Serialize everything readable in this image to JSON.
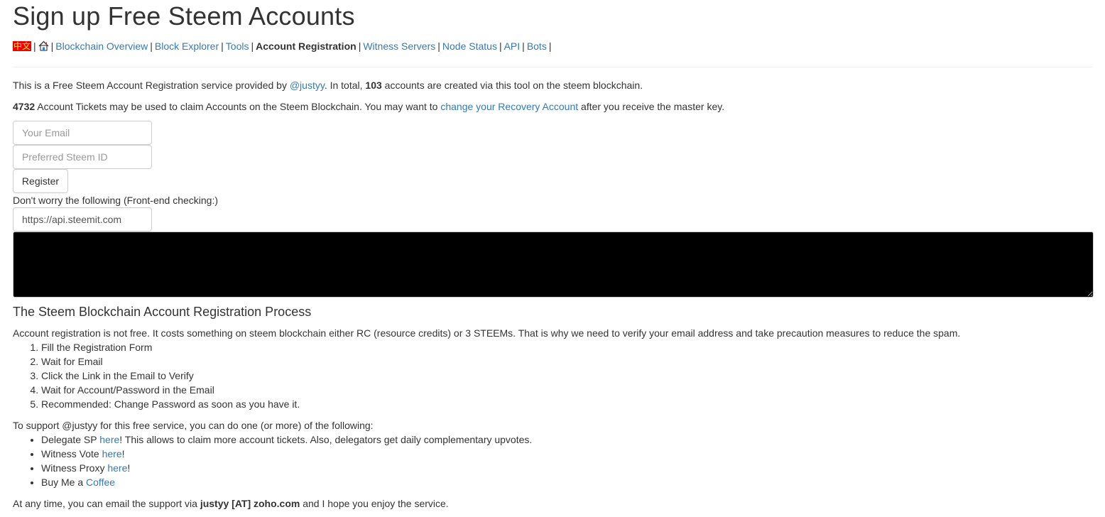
{
  "page_title": "Sign up Free Steem Accounts",
  "nav": {
    "lang_label": "中文",
    "home_icon": "home-icon",
    "items": [
      {
        "label": "Blockchain Overview",
        "current": false
      },
      {
        "label": "Block Explorer",
        "current": false
      },
      {
        "label": "Tools",
        "current": false
      },
      {
        "label": "Account Registration",
        "current": true
      },
      {
        "label": "Witness Servers",
        "current": false
      },
      {
        "label": "Node Status",
        "current": false
      },
      {
        "label": "API",
        "current": false
      },
      {
        "label": "Bots",
        "current": false
      }
    ],
    "separator": "|"
  },
  "intro": {
    "s1": "This is a Free Steem Account Registration service provided by ",
    "provider_link": "@justyy",
    "s2": ". In total, ",
    "count": "103",
    "s3": " accounts are created via this tool on the steem blockchain."
  },
  "tickets": {
    "count": "4732",
    "s1": " Account Tickets may be used to claim Accounts on the Steem Blockchain. You may want to ",
    "link": "change your Recovery Account",
    "s2": " after you receive the master key."
  },
  "form": {
    "email_placeholder": "Your Email",
    "email_value": "",
    "steemid_placeholder": "Preferred Steem ID",
    "steemid_value": "",
    "register_label": "Register",
    "frontend_note": "Don't worry the following (Front-end checking:)",
    "api_value": "https://api.steemit.com"
  },
  "process": {
    "heading": "The Steem Blockchain Account Registration Process",
    "desc": "Account registration is not free. It costs something on steem blockchain either RC (resource credits) or 3 STEEMs. That is why we need to verify your email address and take precaution measures to reduce the spam.",
    "steps": [
      "Fill the Registration Form",
      "Wait for Email",
      "Click the Link in the Email to Verify",
      "Wait for Account/Password in the Email",
      "Recommended: Change Password as soon as you have it."
    ]
  },
  "support": {
    "intro": "To support @justyy for this free service, you can do one (or more) of the following:",
    "items": [
      {
        "before": "Delegate SP ",
        "link": "here",
        "after": "! This allows to claim more account tickets. Also, delegators get daily complementary upvotes."
      },
      {
        "before": "Witness Vote ",
        "link": "here",
        "after": "!"
      },
      {
        "before": "Witness Proxy ",
        "link": "here",
        "after": "!"
      },
      {
        "before": "Buy Me a ",
        "link": "Coffee",
        "after": ""
      }
    ]
  },
  "contact": {
    "s1": "At any time, you can email the support via ",
    "email": "justyy [AT] zoho.com",
    "s2": " and I hope you enjoy the service."
  }
}
